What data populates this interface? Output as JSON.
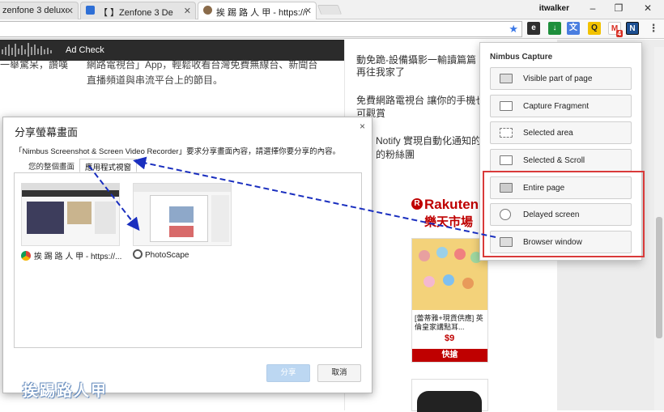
{
  "tabs": [
    {
      "title": "zenfone 3 deluxe \\",
      "favicon": "page-icon"
    },
    {
      "title": "【        】Zenfone 3 De",
      "favicon": "blue-square-icon"
    },
    {
      "title": "挨 踢 路 人 甲 - https://w",
      "favicon": "blog-avatar-icon"
    }
  ],
  "user_name": "itwalker",
  "window_controls": {
    "minimize": "–",
    "maximize": "❐",
    "close": "✕"
  },
  "toolbar_extensions": [
    "evernote-icon",
    "download-icon",
    "translate-icon",
    "search-q-icon",
    "gmail-icon",
    "nimbus-icon",
    "menu-dots-icon"
  ],
  "gmail_badge": "4",
  "site_nav": {
    "ad_check": "Ad Check"
  },
  "article": {
    "line1": "一舉驚呆，讚嘆",
    "line2": "網路電視台」App，輕鬆收看台灣免費無線台、新聞台",
    "line3": "直播頻道與串流平台上的節目。"
  },
  "right_column": {
    "item1_l1": "動免跪-設備攝影一輸讀篇篇",
    "item1_l2": "再往我家了",
    "item2_l1": "免費網路電視台 讓你的手機也",
    "item2_l2": "可觀賞",
    "item3_l1": "Notify 實現自動化通知的",
    "item3_l2": "的粉絲團",
    "rakuten": "Rakuten",
    "rakuten_sub": "樂天市場",
    "product_text": "[蕾蒂雅+現貨供應] 英倫皇家講點耳...",
    "product_price": "$9",
    "product_button": "快搶"
  },
  "share_dialog": {
    "title": "分享螢幕畫面",
    "close": "×",
    "message": "「Nimbus Screenshot & Screen Video Recorder」要求分享畫面內容，請選擇你要分享的內容。",
    "tab_entire": "您的整個畫面",
    "tab_apps": "應用程式視窗",
    "windows": [
      {
        "label": "挨 踢 路 人 甲 - https://...",
        "icon": "chrome-icon"
      },
      {
        "label": "PhotoScape",
        "icon": "photoscape-icon"
      }
    ],
    "share_button": "分享",
    "cancel_button": "取消"
  },
  "nimbus_popup": {
    "title": "Nimbus Capture",
    "items": [
      {
        "label": "Visible part of page",
        "icon": "visible-part-icon"
      },
      {
        "label": "Capture Fragment",
        "icon": "fragment-icon"
      },
      {
        "label": "Selected area",
        "icon": "selected-area-icon"
      },
      {
        "label": "Selected & Scroll",
        "icon": "selected-scroll-icon"
      },
      {
        "label": "Entire page",
        "icon": "entire-page-icon"
      },
      {
        "label": "Delayed screen",
        "icon": "delayed-screen-icon"
      },
      {
        "label": "Browser window",
        "icon": "browser-window-icon"
      }
    ]
  },
  "watermark": "挨踢路人甲",
  "colors": {
    "highlight_red": "#d93a3a",
    "arrow_blue": "#1a2fbf",
    "nav_dark": "#2b2b2b",
    "rakuten_red": "#bf0000"
  }
}
